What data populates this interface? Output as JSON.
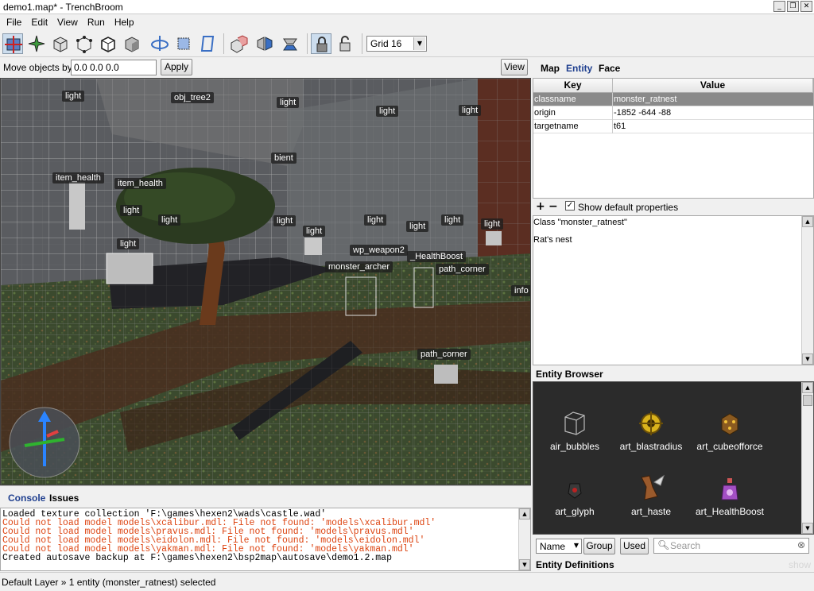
{
  "window": {
    "title": "demo1.map* - TrenchBroom",
    "minimize": "_",
    "restore": "❐",
    "close": "✕"
  },
  "menu": [
    "File",
    "Edit",
    "View",
    "Run",
    "Help"
  ],
  "toolbar": {
    "grid_value": "Grid 16"
  },
  "movebar": {
    "label": "Move objects by",
    "value": "0.0 0.0 0.0",
    "apply_label": "Apply",
    "view_label": "View"
  },
  "viewport_labels": [
    "light",
    "obj_tree2",
    "light",
    "light",
    "light",
    "bient",
    "item_health",
    "item_health",
    "light",
    "light",
    "light",
    "light",
    "light",
    "light",
    "light",
    "light",
    "light",
    "wp_weapon2",
    "_HealthBoost",
    "monster_archer",
    "path_corner",
    "info",
    "path_corner"
  ],
  "console": {
    "tabs": [
      "Console",
      "Issues"
    ],
    "lines": [
      {
        "text": "Loaded texture collection 'F:\\games\\hexen2\\wads\\castle.wad'",
        "error": false
      },
      {
        "text": "Could not load model models\\xcalibur.mdl: File not found: 'models\\xcalibur.mdl'",
        "error": true
      },
      {
        "text": "Could not load model models\\pravus.mdl: File not found: 'models\\pravus.mdl'",
        "error": true
      },
      {
        "text": "Could not load model models\\eidolon.mdl: File not found: 'models\\eidolon.mdl'",
        "error": true
      },
      {
        "text": "Could not load model models\\yakman.mdl: File not found: 'models\\yakman.mdl'",
        "error": true
      },
      {
        "text": "Created autosave backup at F:\\games\\hexen2\\bsp2map\\autosave\\demo1.2.map",
        "error": false
      }
    ]
  },
  "statusbar": {
    "text": "Default Layer » 1 entity (monster_ratnest) selected"
  },
  "inspector": {
    "tabs": [
      "Map",
      "Entity",
      "Face"
    ],
    "active_tab": "Entity",
    "headers": {
      "key": "Key",
      "value": "Value"
    },
    "properties": [
      {
        "key": "classname",
        "value": "monster_ratnest",
        "selected": true
      },
      {
        "key": "origin",
        "value": "-1852 -644 -88",
        "selected": false
      },
      {
        "key": "targetname",
        "value": "t61",
        "selected": false
      }
    ],
    "add": "+",
    "remove": "−",
    "show_default": {
      "label": "Show default properties",
      "checked": true
    },
    "class_line": "Class \"monster_ratnest\"",
    "class_desc": "Rat's nest"
  },
  "entity_browser": {
    "title": "Entity Browser",
    "items": [
      {
        "name": "air_bubbles",
        "icon": "cube-wireframe-icon"
      },
      {
        "name": "art_blastradius",
        "icon": "blast-radius-icon"
      },
      {
        "name": "art_cubeofforce",
        "icon": "cube-of-force-icon"
      },
      {
        "name": "art_glyph",
        "icon": "glyph-icon"
      },
      {
        "name": "art_haste",
        "icon": "haste-icon"
      },
      {
        "name": "art_HealthBoost",
        "icon": "health-boost-icon"
      }
    ],
    "sort_value": "Name",
    "group_label": "Group",
    "used_label": "Used",
    "search_placeholder": "Search"
  },
  "entity_definitions": {
    "title": "Entity Definitions",
    "show": "show"
  },
  "colors": {
    "console_error": "#d41111",
    "selection": "#8a8a8a",
    "tree": "#2f3a24",
    "grid": "#cfcfcf"
  }
}
